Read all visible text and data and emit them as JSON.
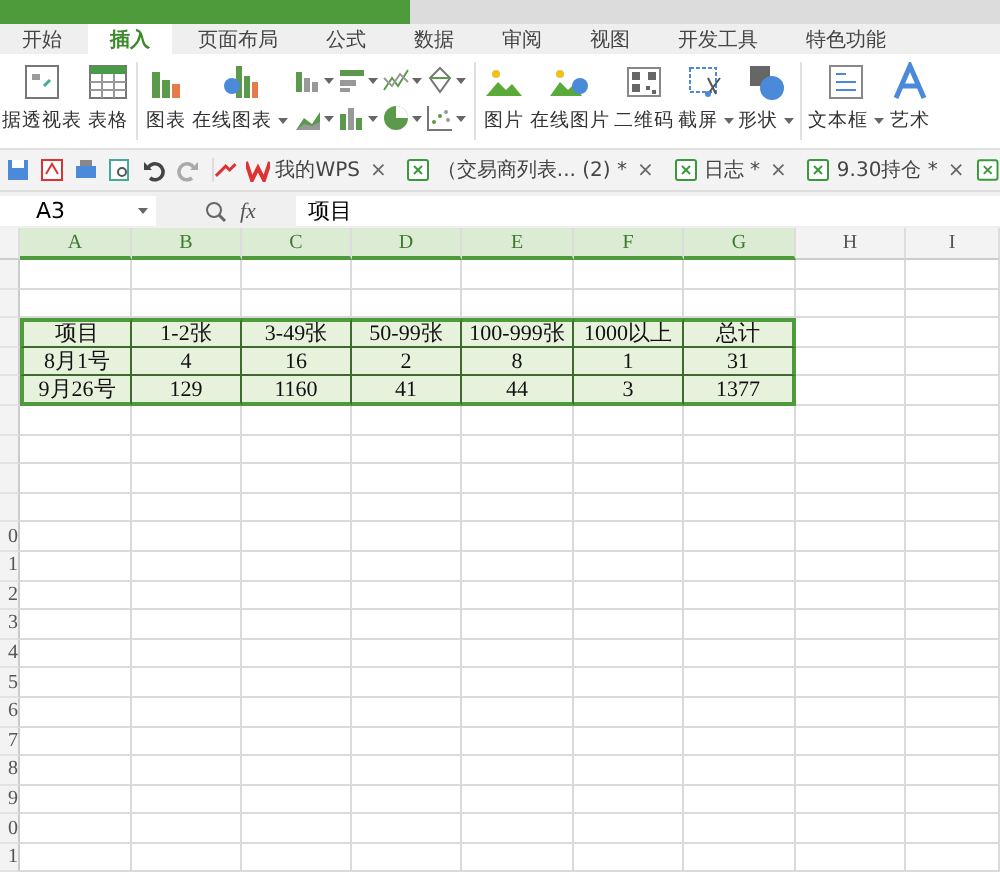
{
  "ribbon_tabs": [
    {
      "label": "开始",
      "selected": false
    },
    {
      "label": "插入",
      "selected": true
    },
    {
      "label": "页面布局",
      "selected": false
    },
    {
      "label": "公式",
      "selected": false
    },
    {
      "label": "数据",
      "selected": false
    },
    {
      "label": "审阅",
      "selected": false
    },
    {
      "label": "视图",
      "selected": false
    },
    {
      "label": "开发工具",
      "selected": false
    },
    {
      "label": "特色功能",
      "selected": false
    }
  ],
  "ribbon": [
    {
      "kind": "large",
      "label": "据透视表",
      "dropdown": false
    },
    {
      "kind": "large",
      "label": "表格",
      "dropdown": false
    },
    {
      "kind": "separator"
    },
    {
      "kind": "large",
      "label": "图表",
      "dropdown": false
    },
    {
      "kind": "large",
      "label": "在线图表",
      "dropdown": true
    },
    {
      "kind": "small-grid"
    },
    {
      "kind": "separator"
    },
    {
      "kind": "large",
      "label": "图片",
      "dropdown": false
    },
    {
      "kind": "large",
      "label": "在线图片",
      "dropdown": false
    },
    {
      "kind": "large",
      "label": "二维码",
      "dropdown": false
    },
    {
      "kind": "large",
      "label": "截屏",
      "dropdown": true
    },
    {
      "kind": "large",
      "label": "形状",
      "dropdown": true
    },
    {
      "kind": "separator"
    },
    {
      "kind": "large",
      "label": "文本框",
      "dropdown": true
    },
    {
      "kind": "large",
      "label": "艺术",
      "dropdown": false
    }
  ],
  "documents": [
    {
      "label": "我的WPS",
      "close": "×"
    },
    {
      "label": "（交易商列表... (2) *",
      "close": "×"
    },
    {
      "label": "日志 *",
      "close": "×"
    },
    {
      "label": "9.30持仓 *",
      "close": "×"
    }
  ],
  "formula_bar": {
    "name_box": "A3",
    "fx": "fx",
    "value": "项目"
  },
  "columns": [
    {
      "label": "A",
      "selected": true
    },
    {
      "label": "B",
      "selected": true
    },
    {
      "label": "C",
      "selected": true
    },
    {
      "label": "D",
      "selected": true
    },
    {
      "label": "E",
      "selected": true
    },
    {
      "label": "F",
      "selected": true
    },
    {
      "label": "G",
      "selected": true
    },
    {
      "label": "H",
      "selected": false
    },
    {
      "label": "I",
      "selected": false
    }
  ],
  "rows": [
    {},
    {},
    {
      "cells": [
        "项目",
        "1-2张",
        "3-49张",
        "50-99张",
        "100-999张",
        "1000以上",
        "总计"
      ]
    },
    {
      "cells": [
        "8月1号",
        "4",
        "16",
        "2",
        "8",
        "1",
        "31"
      ]
    },
    {
      "cells": [
        "9月26号",
        "129",
        "1160",
        "41",
        "44",
        "3",
        "1377"
      ]
    },
    {},
    {},
    {},
    {},
    {
      "header": "0"
    },
    {
      "header": "1"
    },
    {
      "header": "2"
    },
    {
      "header": "3"
    },
    {
      "header": "4"
    },
    {
      "header": "5"
    },
    {
      "header": "6"
    },
    {
      "header": "7"
    },
    {
      "header": "8"
    },
    {
      "header": "9"
    },
    {
      "header": "0"
    },
    {
      "header": "1"
    }
  ]
}
